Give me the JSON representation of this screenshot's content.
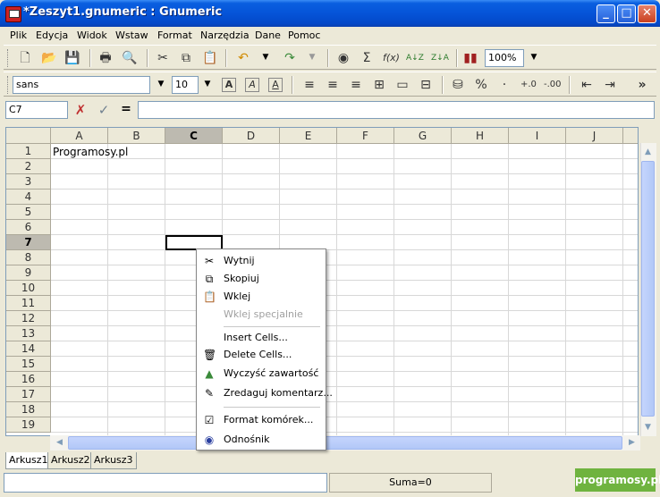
{
  "window": {
    "title": "*Zeszyt1.gnumeric : Gnumeric",
    "minimize": "_",
    "maximize": "□",
    "close": "✕"
  },
  "menubar": [
    "Plik",
    "Edycja",
    "Widok",
    "Wstaw",
    "Format",
    "Narzędzia",
    "Dane",
    "Pomoc"
  ],
  "toolbar": {
    "zoom": "100%",
    "font_name": "sans",
    "font_size": "10",
    "bold": "A",
    "italic": "A",
    "underline": "A",
    "percent": "%",
    "more": "»"
  },
  "entry": {
    "cell_ref": "C7",
    "cancel_icon": "✗",
    "accept_icon": "✓",
    "equals": "=",
    "value": ""
  },
  "grid": {
    "columns": [
      "A",
      "B",
      "C",
      "D",
      "E",
      "F",
      "G",
      "H",
      "I",
      "J"
    ],
    "rows": [
      "1",
      "2",
      "3",
      "4",
      "5",
      "6",
      "7",
      "8",
      "9",
      "10",
      "11",
      "12",
      "13",
      "14",
      "15",
      "16",
      "17",
      "18",
      "19"
    ],
    "selected_column": "C",
    "selected_row": "7",
    "cell_a1": "Programosy.pl"
  },
  "sheets": [
    "Arkusz1",
    "Arkusz2",
    "Arkusz3"
  ],
  "active_sheet": "Arkusz1",
  "status": {
    "sum": "Suma=0",
    "watermark": "programosy.pl"
  },
  "context_menu": {
    "items": [
      {
        "label": "Wytnij",
        "icon": "scissors-icon",
        "disabled": false
      },
      {
        "label": "Skopiuj",
        "icon": "copy-icon",
        "disabled": false
      },
      {
        "label": "Wklej",
        "icon": "paste-icon",
        "disabled": false
      },
      {
        "label": "Wklej specjalnie",
        "icon": "",
        "disabled": true
      },
      {
        "label": "Insert Cells...",
        "icon": "",
        "disabled": false
      },
      {
        "label": "Delete Cells...",
        "icon": "trash-icon",
        "disabled": false
      },
      {
        "label": "Wyczyść zawartość",
        "icon": "clear-icon",
        "disabled": false
      },
      {
        "label": "Zredaguj komentarz...",
        "icon": "comment-icon",
        "disabled": false
      },
      {
        "label": "Format komórek...",
        "icon": "format-icon",
        "disabled": false
      },
      {
        "label": "Odnośnik",
        "icon": "link-icon",
        "disabled": false
      }
    ]
  }
}
